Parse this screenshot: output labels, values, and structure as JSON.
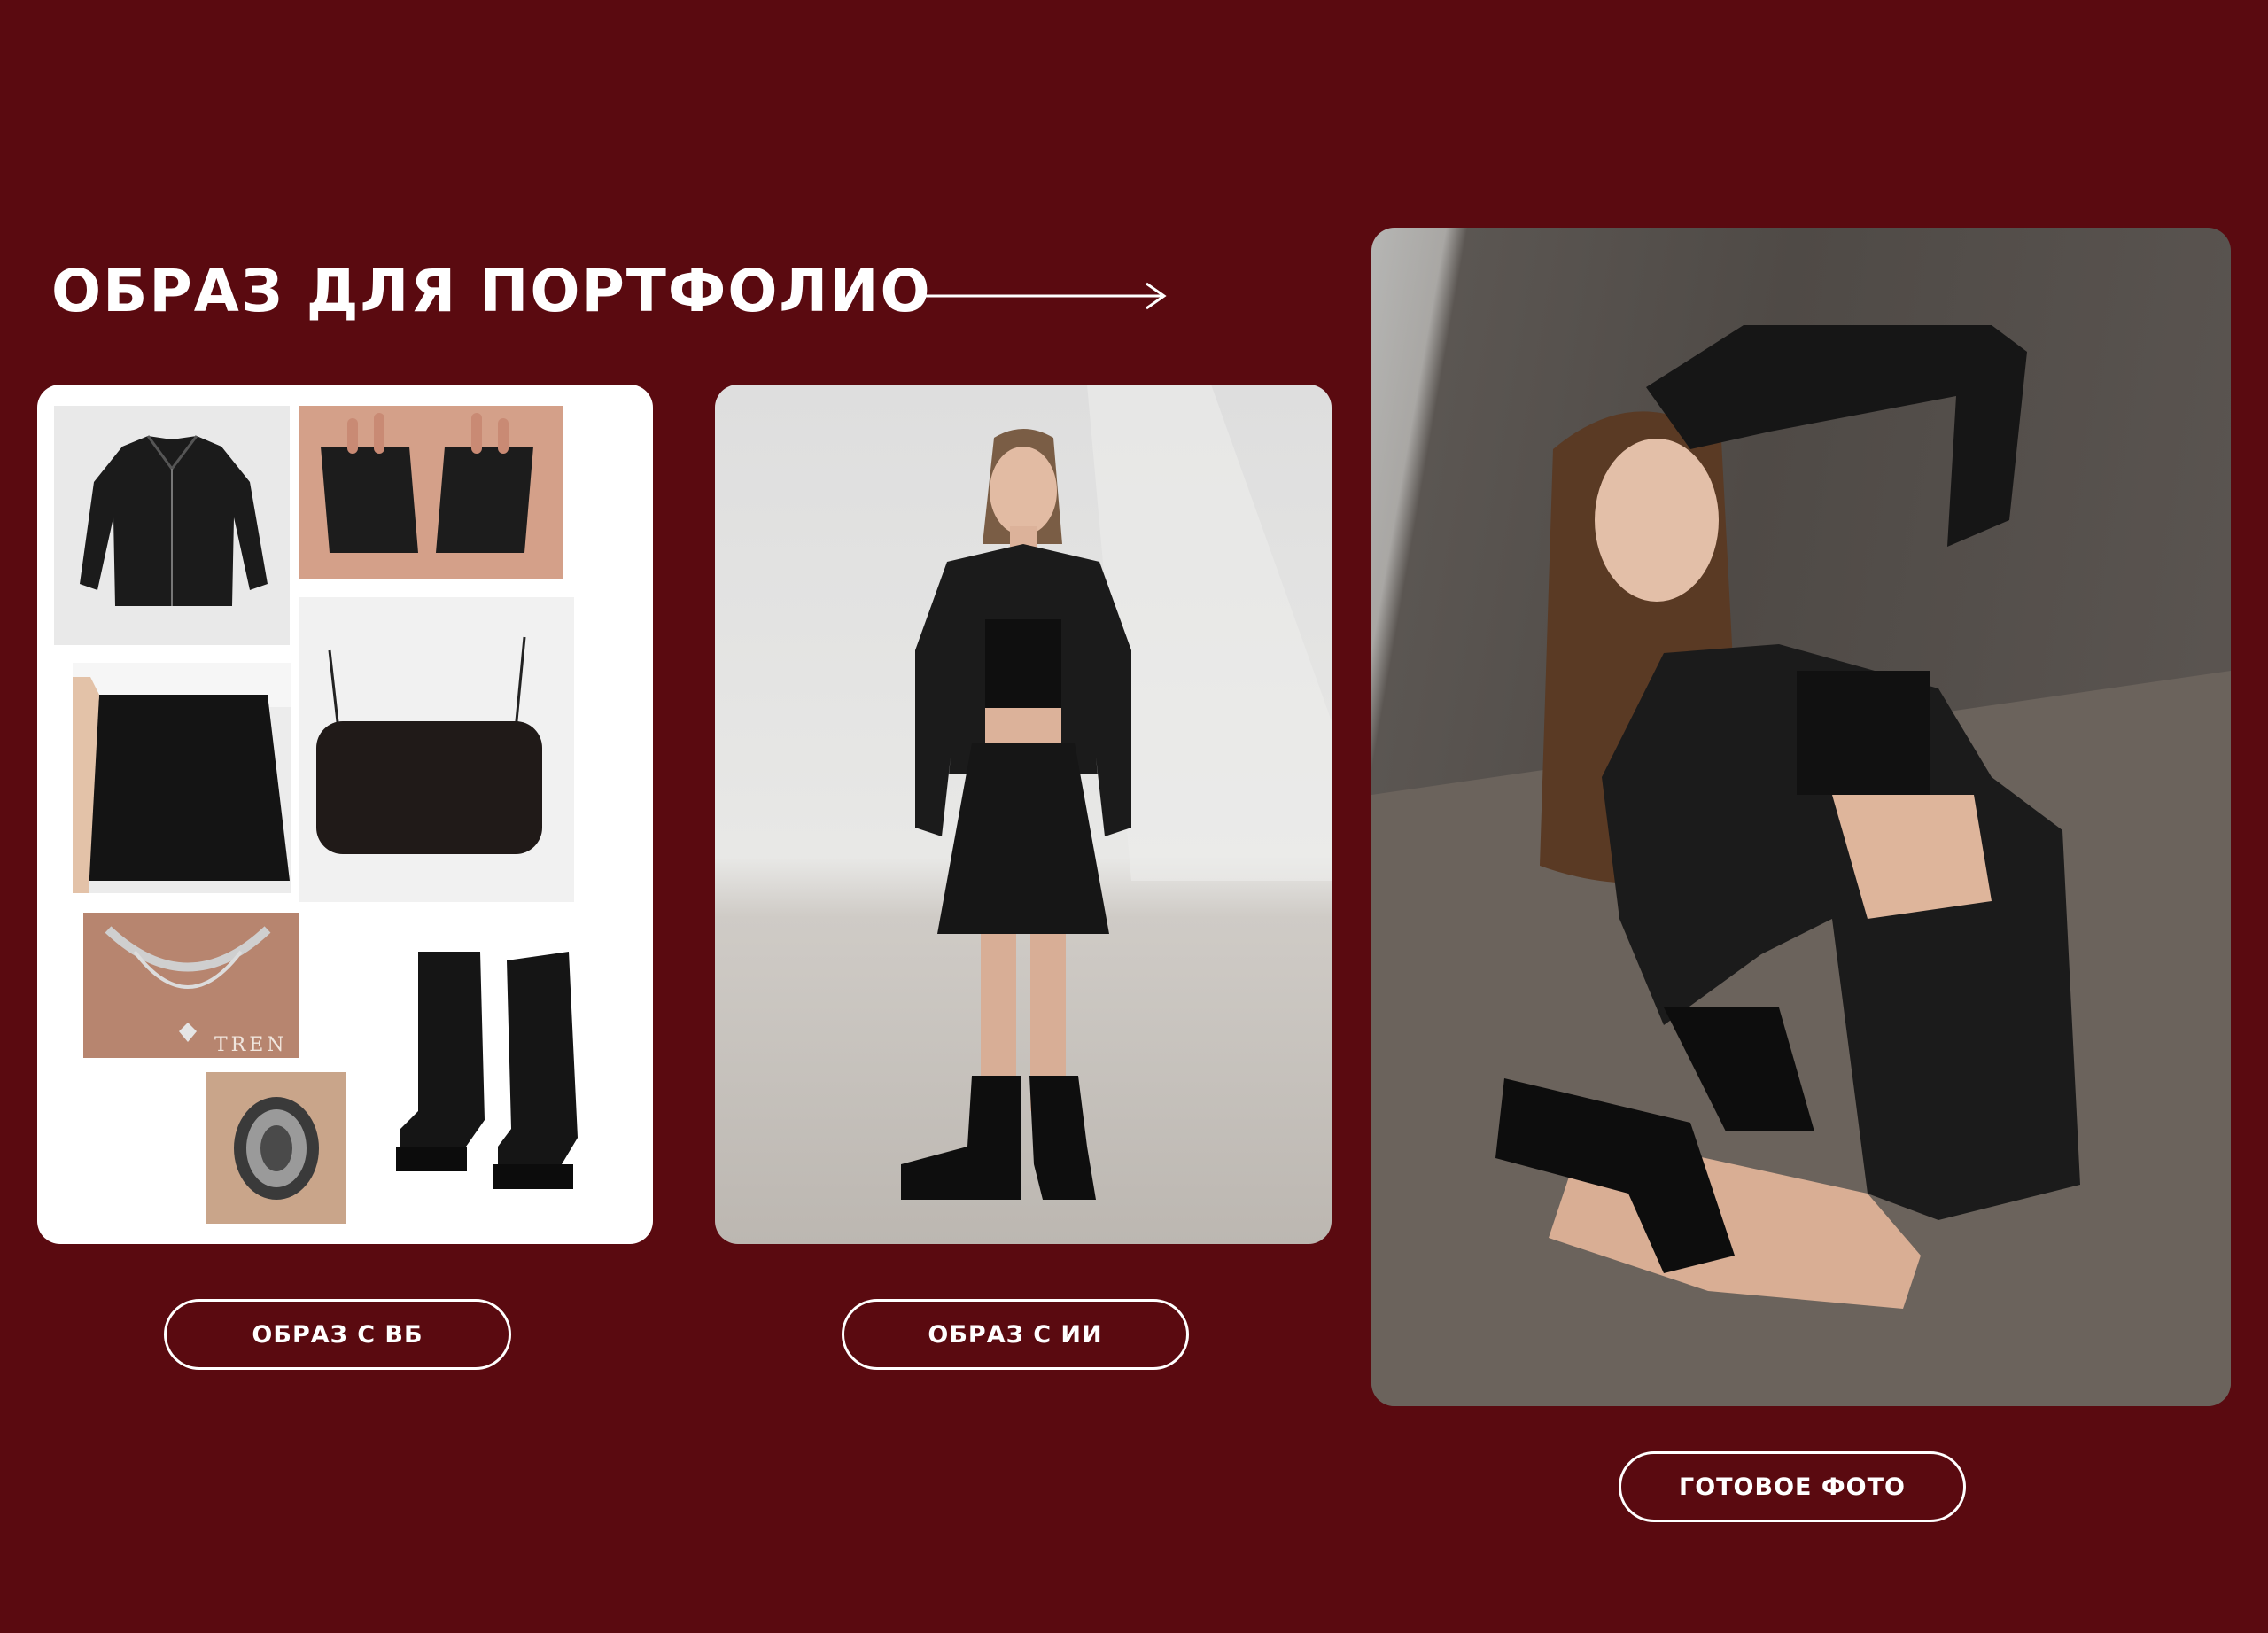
{
  "header": {
    "title": "ОБРАЗ ДЛЯ ПОРТФОЛИО"
  },
  "buttons": {
    "wb_look": "ОБРАЗ С ВБ",
    "ai_look": "ОБРАЗ С ИИ",
    "final_photo": "ГОТОВОЕ ФОТО"
  },
  "collage": {
    "necklace_watermark": "TREN"
  },
  "colors": {
    "background": "#5a0a10",
    "text": "#ffffff",
    "card": "#ffffff"
  }
}
